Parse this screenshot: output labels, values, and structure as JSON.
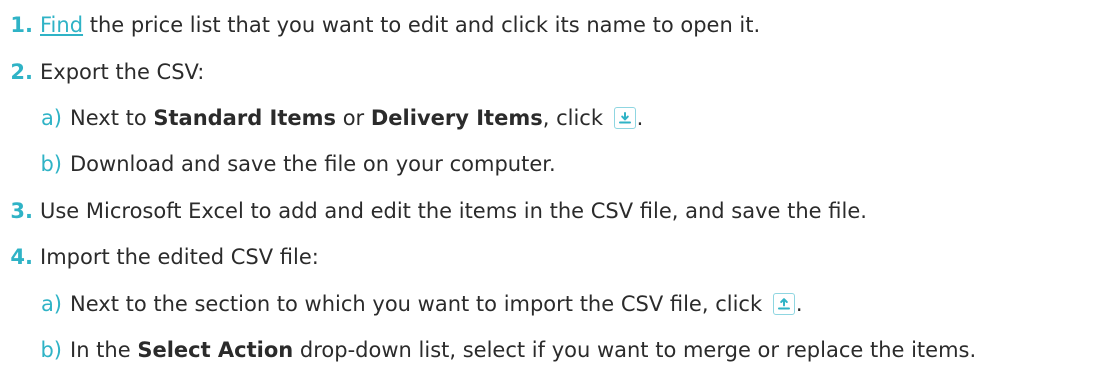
{
  "steps": [
    {
      "number": "1.",
      "link": "Find",
      "text": " the price list that you want to edit and click its name to open it."
    },
    {
      "number": "2.",
      "text": "Export the CSV:",
      "substeps": [
        {
          "letter": "a)",
          "pre": "Next to ",
          "bold1": "Standard Items",
          "mid": " or ",
          "bold2": "Delivery Items",
          "post": ", click ",
          "icon": "download-icon",
          "end": "."
        },
        {
          "letter": "b)",
          "text": "Download and save the file on your computer."
        }
      ]
    },
    {
      "number": "3.",
      "text": "Use Microsoft Excel to add and edit the items in the CSV file, and save the file."
    },
    {
      "number": "4.",
      "text": "Import the edited CSV file:",
      "substeps": [
        {
          "letter": "a)",
          "pre": "Next to the section to which you want to import the CSV file, click ",
          "icon": "upload-icon",
          "end": "."
        },
        {
          "letter": "b)",
          "pre": "In the ",
          "bold": "Select Action",
          "post": " drop-down list, select if you want to merge or replace the items."
        }
      ]
    }
  ],
  "colors": {
    "accent": "#2fb3c6",
    "text": "#2b2b2b",
    "icon_border": "#8fd6e1"
  }
}
